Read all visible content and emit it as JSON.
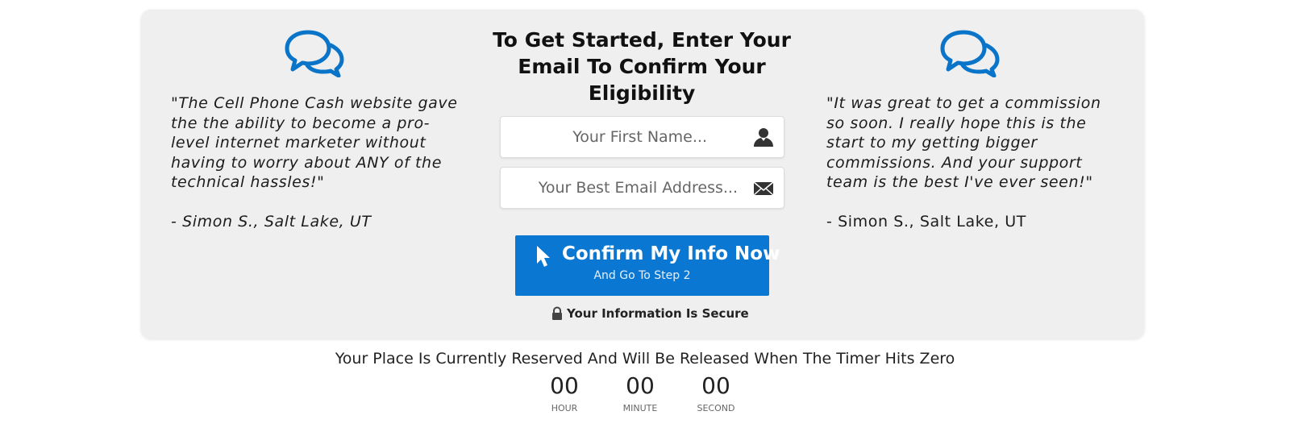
{
  "form": {
    "headline": "To Get Started, Enter Your Email To Confirm Your Eligibility",
    "first_name_placeholder": "Your First Name...",
    "email_placeholder": "Your Best Email Address...",
    "cta_main": "Confirm My Info Now",
    "cta_sub": "And Go To Step 2",
    "secure_text": "Your Information Is Secure",
    "accent_color": "#0a78d2"
  },
  "testimonials": [
    {
      "quote": "\"The Cell Phone Cash website gave the the ability to become a pro-level internet marketer without having to worry about ANY of the technical hassles!\"",
      "author": "- Simon S., Salt Lake, UT"
    },
    {
      "quote": "\"It was great to get a commission so soon. I really hope this is the start to my getting bigger commissions. And your support team is the best I've ever seen!\"",
      "author": "- Simon S., Salt Lake, UT"
    }
  ],
  "timer": {
    "headline": "Your Place Is Currently Reserved And Will Be Released When The Timer Hits Zero",
    "hours": "00",
    "minutes": "00",
    "seconds": "00",
    "hour_label": "HOUR",
    "minute_label": "MINUTE",
    "second_label": "SECOND"
  },
  "icons": {
    "testimonial": "chat-bubbles-icon",
    "first_name": "user-icon",
    "email": "envelope-icon",
    "cta": "cursor-pointer-icon",
    "secure": "lock-icon"
  }
}
